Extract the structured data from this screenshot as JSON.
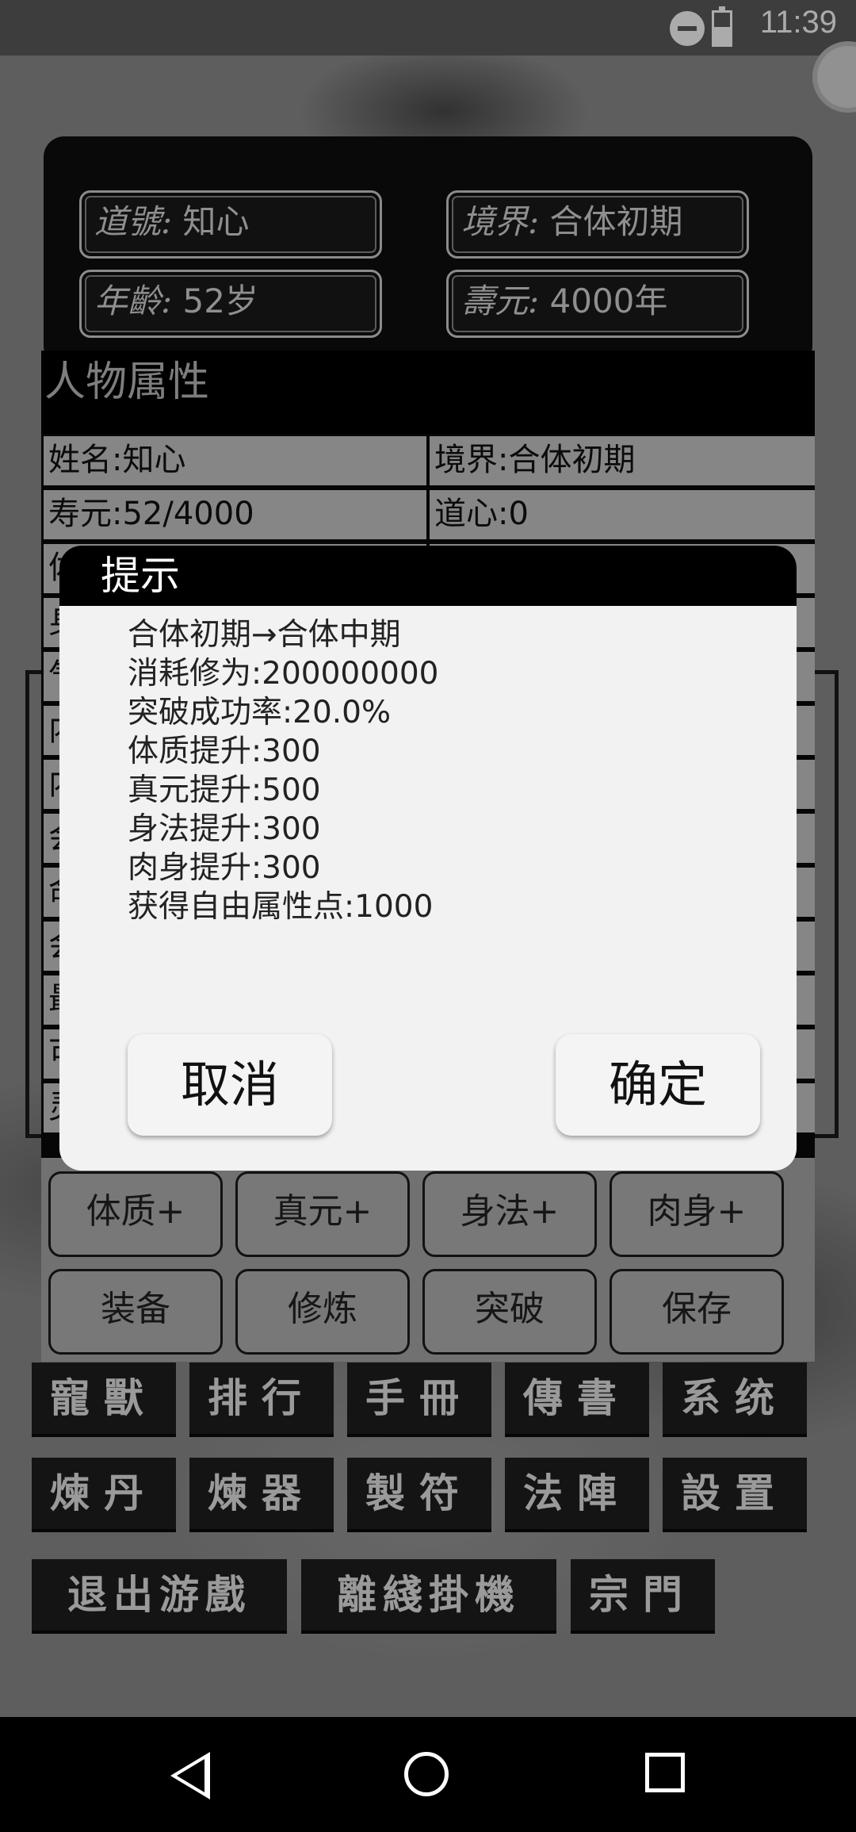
{
  "status_bar": {
    "time": "11:39"
  },
  "profile": {
    "name_label": "道號:",
    "name_value": "知心",
    "realm_label": "境界:",
    "realm_value": "合体初期",
    "age_label": "年齡:",
    "age_value": "52岁",
    "lifespan_label": "壽元:",
    "lifespan_value": "4000年"
  },
  "attributes": {
    "title": "人物属性",
    "rows": [
      {
        "left": "姓名:知心",
        "right": "境界:合体初期"
      },
      {
        "left": "寿元:52/4000",
        "right": "道心:0"
      },
      {
        "left": "体",
        "right": ""
      },
      {
        "left": "身",
        "right": ""
      },
      {
        "left": "气",
        "right": ""
      },
      {
        "left": "内",
        "right": ""
      },
      {
        "left": "内",
        "right": ""
      },
      {
        "left": "会",
        "right": ""
      },
      {
        "left": "命",
        "right": ""
      },
      {
        "left": "会",
        "right": ""
      },
      {
        "left": "最",
        "right": ""
      },
      {
        "left": "可",
        "right": ""
      },
      {
        "left": "灵",
        "right": ""
      }
    ]
  },
  "stat_buttons": [
    "体质+",
    "真元+",
    "身法+",
    "肉身+"
  ],
  "action_buttons": [
    "装备",
    "修炼",
    "突破",
    "保存"
  ],
  "menu_row1": [
    "寵獸",
    "排行",
    "手冊",
    "傳書",
    "系统"
  ],
  "menu_row2": [
    "煉丹",
    "煉器",
    "製符",
    "法陣",
    "設置"
  ],
  "menu_row3": [
    "退出游戲",
    "離綫掛機",
    "宗門"
  ],
  "dialog": {
    "title": "提示",
    "lines": [
      "合体初期→合体中期",
      "消耗修为:200000000",
      "突破成功率:20.0%",
      "体质提升:300",
      "真元提升:500",
      "身法提升:300",
      "肉身提升:300",
      "获得自由属性点:1000"
    ],
    "cancel_label": "取消",
    "confirm_label": "确定"
  }
}
